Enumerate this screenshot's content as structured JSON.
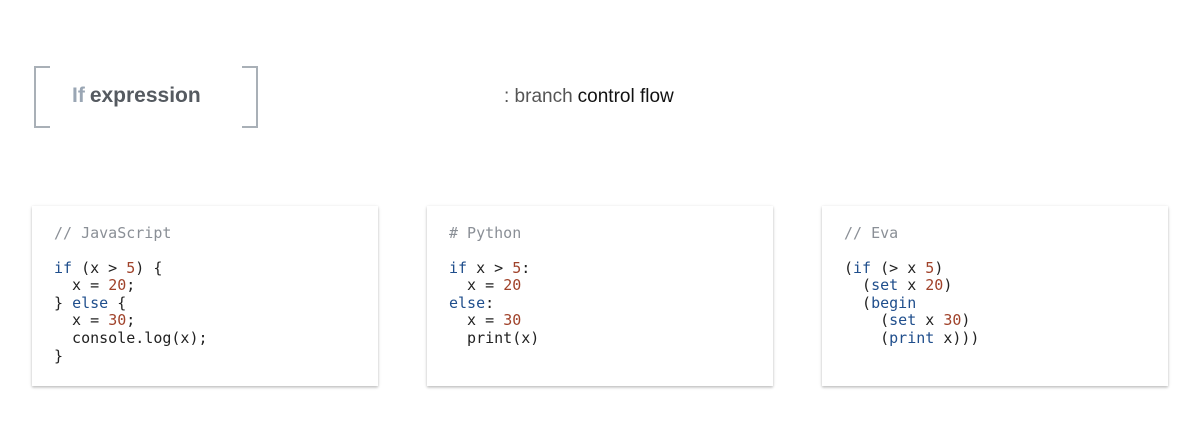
{
  "header": {
    "title_keyword": "If",
    "title_rest": "expression",
    "subtitle_light": ": branch",
    "subtitle_dark": "control flow"
  },
  "cards": [
    {
      "comment": "// JavaScript",
      "lines": [
        "if (x > 5) {",
        "  x = 20;",
        "} else {",
        "  x = 30;",
        "  console.log(x);",
        "}"
      ]
    },
    {
      "comment": "# Python",
      "lines": [
        "if x > 5:",
        "  x = 20",
        "else:",
        "  x = 30",
        "  print(x)"
      ]
    },
    {
      "comment": "// Eva",
      "lines": [
        "(if (> x 5)",
        "  (set x 20)",
        "  (begin",
        "    (set x 30)",
        "    (print x)))"
      ]
    }
  ],
  "colors": {
    "keyword": "#1f4e8c",
    "number": "#a0422a",
    "comment": "#8a8f96",
    "title_keyword": "#9aa6b4",
    "bracket": "#a9b0b7"
  }
}
